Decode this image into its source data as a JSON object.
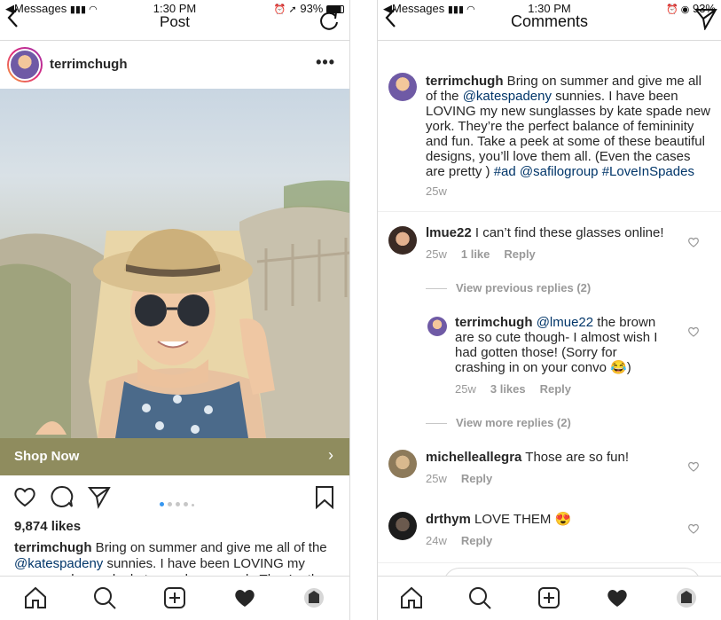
{
  "left": {
    "status": {
      "carrier": "Messages",
      "time": "1:30 PM",
      "battery": "93%"
    },
    "nav": {
      "title": "Post"
    },
    "post": {
      "username": "terrimchugh",
      "shop_now": "Shop Now",
      "likes": "9,874 likes",
      "caption_user": "terrimchugh",
      "caption_text1": " Bring on summer and give me all of the ",
      "caption_mention": "@katespadeny",
      "caption_text2": " sunnies. I have been LOVING my new sunglasses by kate spade new york. They’re the"
    },
    "carousel": {
      "count": 5,
      "active": 0
    }
  },
  "right": {
    "status": {
      "carrier": "Messages",
      "time": "1:30 PM",
      "battery": "93%"
    },
    "nav": {
      "title": "Comments"
    },
    "caption": {
      "user": "terrimchugh",
      "t1": " Bring on summer and give me all of the ",
      "mention": "@katespadeny",
      "t2": " sunnies. I have been LOVING my new sunglasses by kate spade new york. They’re the perfect balance of femininity and fun. Take a peek at some of these beautiful designs, you’ll love them all. (Even the cases are pretty ) ",
      "tag1": "#ad",
      "sp1": " ",
      "tag2": "@safilogroup",
      "sp2": " ",
      "tag3": "#LoveInSpades",
      "time": "25w"
    },
    "comments": [
      {
        "user": "lmue22",
        "text": " I can’t find these glasses online!",
        "time": "25w",
        "likes": "1 like",
        "reply": "Reply"
      },
      {
        "user": "terrimchugh",
        "mention": "@lmue22",
        "text": " the brown are so cute though- I almost wish I had gotten those! (Sorry for crashing in on your convo ",
        "emoji": "😂",
        "text_end": ")",
        "time": "25w",
        "likes": "3 likes",
        "reply": "Reply"
      },
      {
        "user": "michelleallegra",
        "text": " Those are so fun!",
        "time": "25w",
        "reply": "Reply"
      },
      {
        "user": "drthym",
        "text": " LOVE THEM ",
        "emoji": "😍",
        "time": "24w",
        "reply": "Reply"
      }
    ],
    "view_previous": "View previous replies (2)",
    "view_more": "View more replies (2)"
  },
  "colors": {
    "link": "#003569",
    "shop_bar": "#8f8c5e",
    "carousel_active": "#3897f0",
    "meta": "#999999"
  }
}
